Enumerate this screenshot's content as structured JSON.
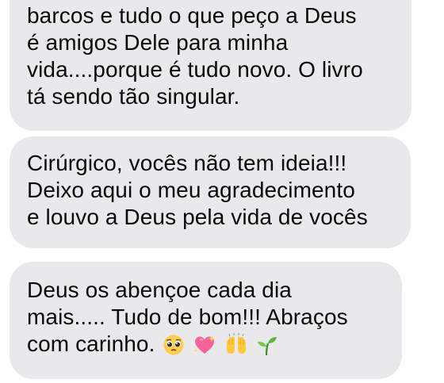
{
  "messages": [
    {
      "lines": [
        "barcos e tudo o que peço a Deus",
        "é amigos Dele para minha",
        "vida....porque é tudo novo. O livro",
        "tá sendo tão singular."
      ]
    },
    {
      "lines": [
        "Cirúrgico, vocês não tem ideia!!!",
        "Deixo aqui o meu agradecimento",
        "e louvo a Deus pela vida de vocês"
      ]
    },
    {
      "lines": [
        "Deus os abençoe cada dia",
        "mais..... Tudo de bom!!! Abraços",
        "com carinho."
      ],
      "emojis": [
        "pleading-face",
        "sparkling-heart",
        "raising-hands",
        "seedling"
      ]
    }
  ],
  "colors": {
    "bubble_background": "#e9e9eb",
    "text": "#0b0b0b",
    "page_background": "#ffffff"
  }
}
